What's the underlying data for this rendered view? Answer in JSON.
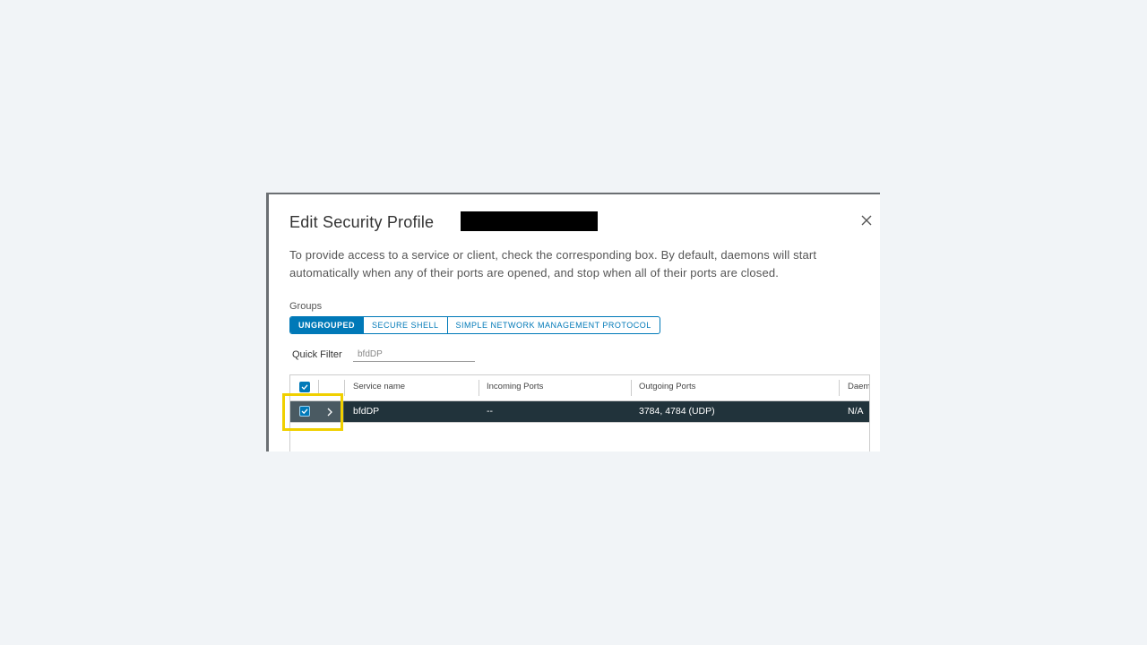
{
  "dialog": {
    "title": "Edit Security Profile",
    "description": "To provide access to a service or client, check the corresponding box. By default, daemons will start automatically when any of their ports are opened, and stop when all of their ports are closed."
  },
  "groups": {
    "label": "Groups",
    "tabs": [
      "UNGROUPED",
      "SECURE SHELL",
      "SIMPLE NETWORK MANAGEMENT PROTOCOL"
    ],
    "active": "UNGROUPED"
  },
  "filter": {
    "label": "Quick Filter",
    "value": "bfdDP"
  },
  "table": {
    "columns": [
      "Service name",
      "Incoming Ports",
      "Outgoing Ports",
      "Daemon"
    ],
    "rows": [
      {
        "service": "bfdDP",
        "incoming": "--",
        "outgoing": "3784, 4784 (UDP)",
        "daemon": "N/A",
        "checked": true
      }
    ]
  },
  "icons": {
    "close": "close-icon",
    "expand": "chevron-right-icon",
    "check": "check-icon"
  },
  "colors": {
    "accent": "#0079b8",
    "selected_row": "#21333b",
    "highlight": "#f0d000"
  }
}
